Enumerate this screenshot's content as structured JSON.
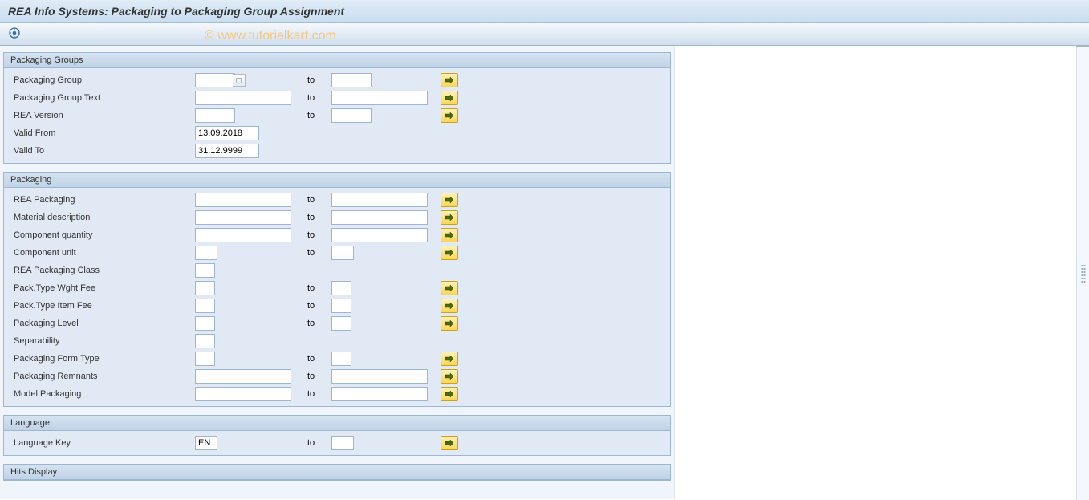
{
  "window": {
    "title": "REA Info Systems: Packaging to Packaging Group Assignment"
  },
  "watermark": "© www.tutorialkart.com",
  "labels": {
    "to": "to"
  },
  "groups": {
    "packaging_groups": {
      "header": "Packaging Groups",
      "fields": {
        "packaging_group": "Packaging Group",
        "packaging_group_text": "Packaging Group Text",
        "rea_version": "REA Version",
        "valid_from": "Valid From",
        "valid_to": "Valid To"
      },
      "values": {
        "valid_from": "13.09.2018",
        "valid_to": "31.12.9999"
      }
    },
    "packaging": {
      "header": "Packaging",
      "fields": {
        "rea_packaging": "REA Packaging",
        "material_description": "Material description",
        "component_quantity": "Component quantity",
        "component_unit": "Component unit",
        "rea_packaging_class": "REA Packaging Class",
        "pack_type_wght_fee": "Pack.Type Wght Fee",
        "pack_type_item_fee": "Pack.Type Item Fee",
        "packaging_level": "Packaging Level",
        "separability": "Separability",
        "packaging_form_type": "Packaging Form Type",
        "packaging_remnants": "Packaging Remnants",
        "model_packaging": "Model Packaging"
      }
    },
    "language": {
      "header": "Language",
      "fields": {
        "language_key": "Language Key"
      },
      "values": {
        "language_key": "EN"
      }
    },
    "hits_display": {
      "header": "Hits Display"
    }
  }
}
